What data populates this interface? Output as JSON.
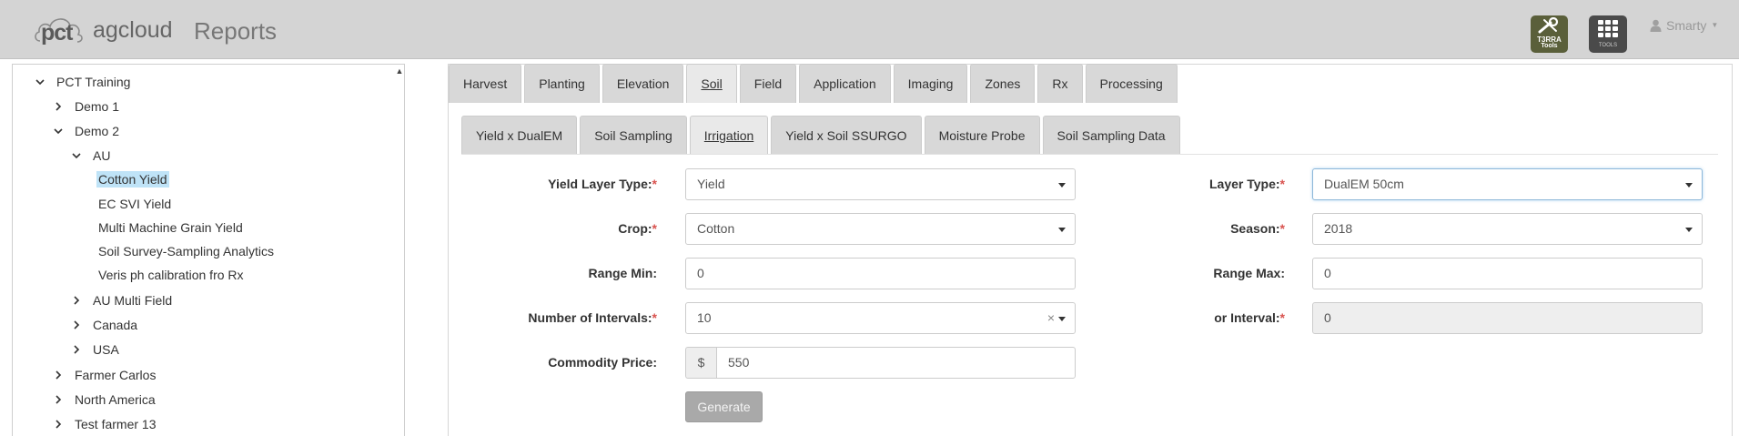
{
  "header": {
    "logo_pct": "pct",
    "logo_agcloud": "agcloud",
    "title": "Reports",
    "terra_tools": {
      "line1": "T3RRA",
      "line2": "Tools"
    },
    "tools_label": "TOOLS",
    "user_name": "Smarty",
    "icons": [
      "user-icon",
      "wrench-icon",
      "grid-icon",
      "caret-down-icon"
    ]
  },
  "tree": {
    "root": "PCT Training",
    "items": [
      {
        "label": "Demo 1",
        "state": "collapsed"
      },
      {
        "label": "Demo 2",
        "state": "expanded"
      },
      {
        "label": "AU",
        "state": "expanded"
      },
      {
        "label": "Cotton Yield",
        "state": "selected"
      },
      {
        "label": "EC SVI Yield"
      },
      {
        "label": "Multi Machine Grain Yield"
      },
      {
        "label": "Soil Survey-Sampling Analytics"
      },
      {
        "label": "Veris ph calibration fro Rx"
      },
      {
        "label": "AU Multi Field",
        "state": "collapsed"
      },
      {
        "label": "Canada",
        "state": "collapsed"
      },
      {
        "label": "USA",
        "state": "collapsed"
      },
      {
        "label": "Farmer Carlos",
        "state": "collapsed"
      },
      {
        "label": "North America",
        "state": "collapsed"
      },
      {
        "label": "Test farmer 13",
        "state": "collapsed"
      }
    ]
  },
  "tabs": {
    "primary": [
      "Harvest",
      "Planting",
      "Elevation",
      "Soil",
      "Field",
      "Application",
      "Imaging",
      "Zones",
      "Rx",
      "Processing"
    ],
    "primary_active": "Soil",
    "secondary": [
      "Yield x DualEM",
      "Soil Sampling",
      "Irrigation",
      "Yield x Soil SSURGO",
      "Moisture Probe",
      "Soil Sampling Data"
    ],
    "secondary_active": "Irrigation"
  },
  "form": {
    "yield_layer_type": {
      "label": "Yield Layer Type:",
      "required": "*",
      "value": "Yield"
    },
    "crop": {
      "label": "Crop:",
      "required": "*",
      "value": "Cotton"
    },
    "range_min": {
      "label": "Range Min:",
      "value": "0"
    },
    "intervals": {
      "label": "Number of Intervals:",
      "required": "*",
      "value": "10",
      "clear": "×"
    },
    "commodity_price": {
      "label": "Commodity Price:",
      "prefix": "$",
      "value": "550"
    },
    "layer_type": {
      "label": "Layer Type:",
      "required": "*",
      "value": "DualEM 50cm"
    },
    "season": {
      "label": "Season:",
      "required": "*",
      "value": "2018"
    },
    "range_max": {
      "label": "Range Max:",
      "value": "0"
    },
    "or_interval": {
      "label": "or Interval:",
      "required": "*",
      "value": "0"
    },
    "generate_label": "Generate"
  },
  "colors": {
    "header_bg": "#d4d4d4",
    "tab_bg": "#d8d8d8",
    "selected_bg": "#bfe3f7",
    "required": "#d9534f",
    "terra_bg": "#5a5f3a",
    "tools_bg": "#4a4a4a"
  }
}
